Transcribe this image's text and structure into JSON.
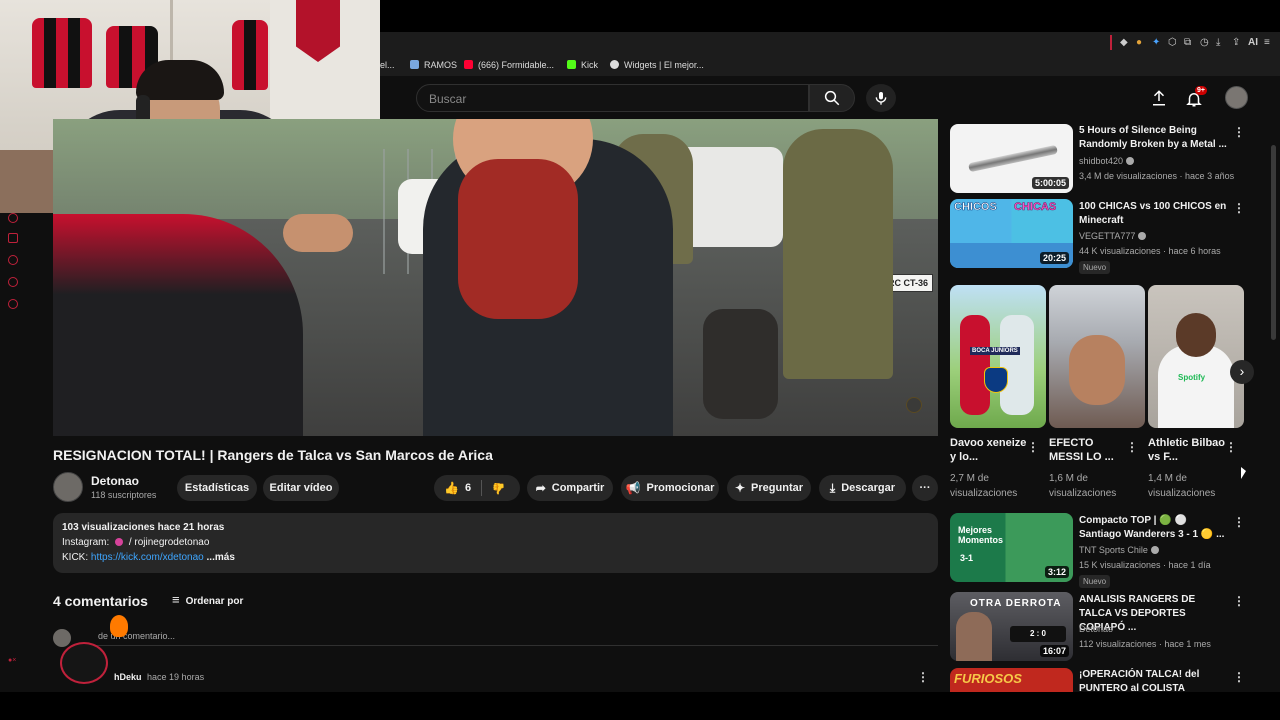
{
  "bookmarks": [
    {
      "label": "el..."
    },
    {
      "label": "RAMOS"
    },
    {
      "label": "(666) Formidable..."
    },
    {
      "label": "Kick"
    },
    {
      "label": "Widgets | El mejor..."
    }
  ],
  "toolbar": {
    "ai_label": "AI"
  },
  "search": {
    "placeholder": "Buscar"
  },
  "header": {
    "notifications_badge": "9+"
  },
  "video": {
    "title": "RESIGNACION TOTAL! | Rangers de Talca vs San Marcos de Arica",
    "channel": "Detonao",
    "subscribers": "118 suscriptores",
    "buttons": {
      "stats": "Estadísticas",
      "edit": "Editar vídeo",
      "likes": "6",
      "share": "Compartir",
      "promote": "Promocionar",
      "ask": "Preguntar",
      "download": "Descargar"
    },
    "jersey_caption": "RC CT-36"
  },
  "description": {
    "stats_line": "103 visualizaciones  hace 21 horas",
    "instagram_label": "Instagram:",
    "instagram_value": "/ rojinegrodetonao",
    "kick_label": "KICK:",
    "kick_link": "https://kick.com/xdetonao",
    "more": " ...más"
  },
  "comments": {
    "count_label": "4 comentarios",
    "sort_label": "Ordenar por",
    "add_placeholder": "de un comentario...",
    "first_author": "hDeku",
    "first_time": "hace 19 horas"
  },
  "recommended": [
    {
      "title": "5 Hours of Silence Being Randomly Broken by a Metal ...",
      "channel": "shidbot420",
      "meta": "3,4 M de visualizaciones · hace 3 años",
      "duration": "5:00:05",
      "badge": ""
    },
    {
      "title": "100 CHICAS vs 100 CHICOS en Minecraft",
      "channel": "VEGETTA777",
      "meta": "44 K visualizaciones · hace 6 horas",
      "duration": "20:25",
      "badge": "Nuevo",
      "thumb_left": "CHICOS",
      "thumb_right": "CHICAS"
    },
    {
      "title": "Compacto TOP | 🟢 ⚪ Santiago Wanderers 3 - 1 🟡 ...",
      "channel": "TNT Sports Chile",
      "meta": "15 K visualizaciones · hace 1 día",
      "duration": "3:12",
      "badge": "Nuevo",
      "thumb_text": "Mejores Momentos",
      "thumb_score": "3-1"
    },
    {
      "title": "ANALISIS RANGERS DE TALCA VS DEPORTES COPIAPÓ ...",
      "channel": "Detonao",
      "meta": "112 visualizaciones · hace 1 mes",
      "duration": "16:07",
      "badge": "",
      "thumb_text": "OTRA DERROTA",
      "thumb_score": "2 : 0"
    },
    {
      "title": "¡OPERACIÓN TALCA! del PUNTERO al COLISTA",
      "channel": "",
      "meta": "",
      "duration": "",
      "badge": "",
      "thumb_text": "FURIOSOS"
    }
  ],
  "shorts": [
    {
      "title": "Davoo xeneize y lo...",
      "views": "2,7 M de visualizaciones",
      "caption": "BOCA JUNIORS"
    },
    {
      "title": "EFECTO MESSI LO ...",
      "views": "1,6 M de visualizaciones"
    },
    {
      "title": "Athletic Bilbao vs F...",
      "views": "1,4 M de visualizaciones",
      "caption": "Spotify"
    }
  ],
  "colors": {
    "accent": "#ff0033",
    "bg": "#0f0f0f",
    "surface": "#272727"
  }
}
